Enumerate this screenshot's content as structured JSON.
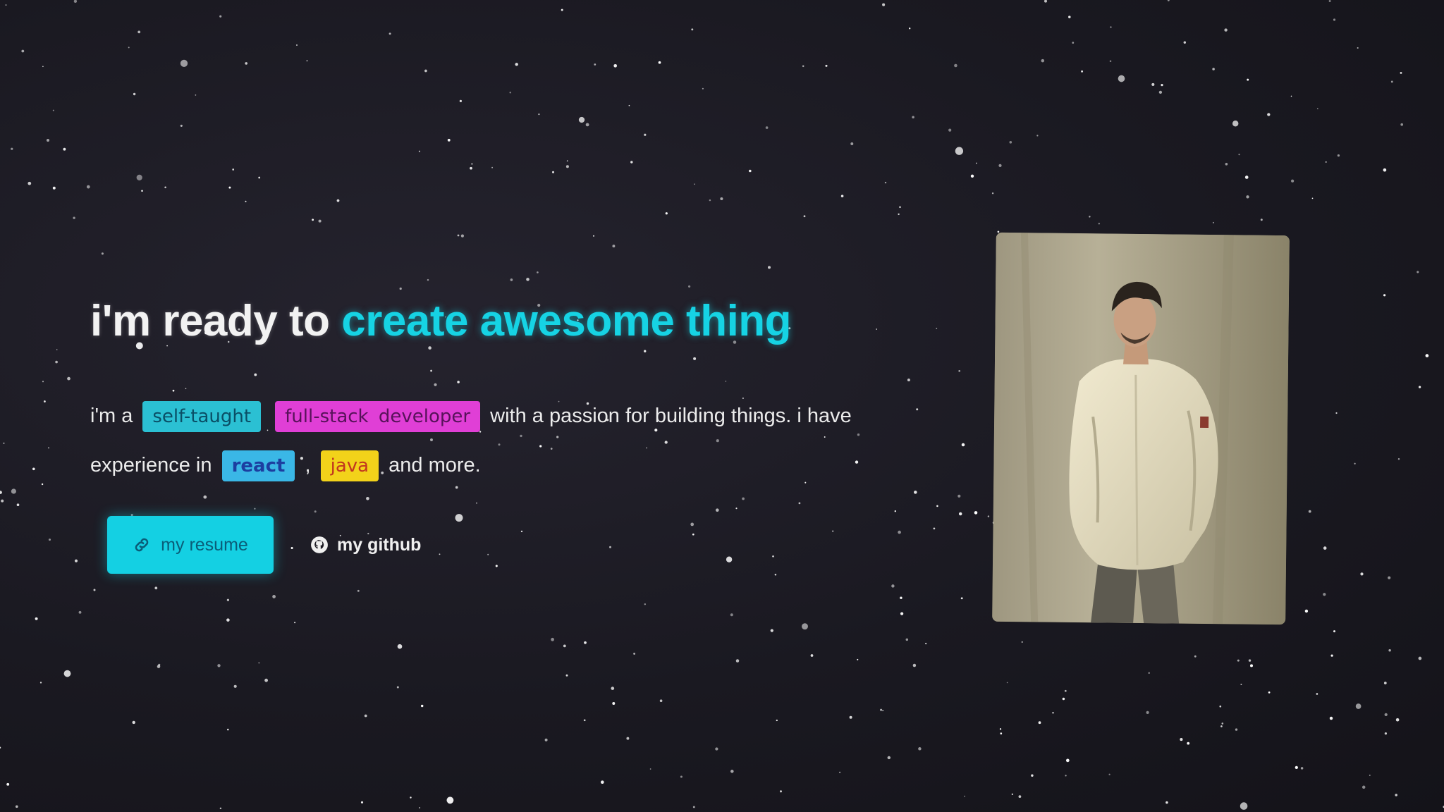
{
  "hero": {
    "headline_prefix": "i'm ready to",
    "headline_accent": "create awesome thing",
    "intro": {
      "part1": "i'm a",
      "tag1": "self-taught",
      "tag2": "full-stack developer",
      "part2": "with a passion for building things. i have experience in",
      "tag3": "react",
      "separator": ",",
      "tag4": "java",
      "part3": "and more."
    }
  },
  "actions": {
    "resume_label": "my resume",
    "github_label": "my github"
  },
  "icons": {
    "resume": "link-icon",
    "github": "github-icon"
  },
  "colors": {
    "background": "#1b1a22",
    "accent": "#16d3e4",
    "tag_self_taught": "#2bc0d3",
    "tag_full_stack": "#e03fd6",
    "tag_react": "#3ab7e6",
    "tag_java": "#f2d21a"
  }
}
